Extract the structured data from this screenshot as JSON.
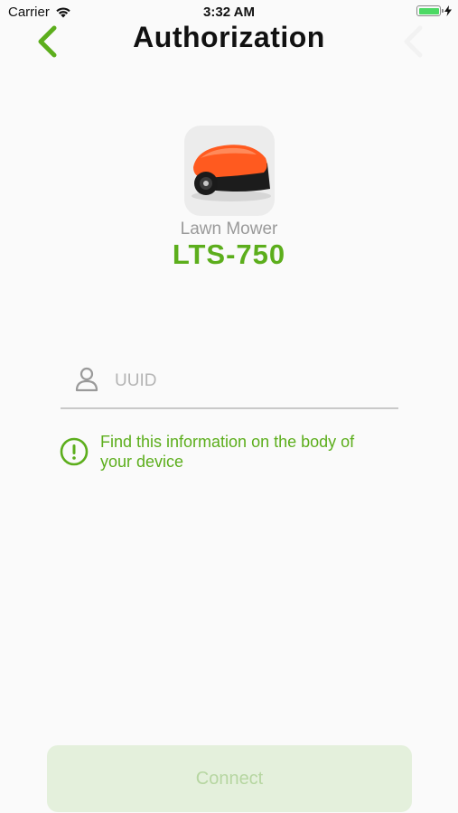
{
  "status_bar": {
    "carrier": "Carrier",
    "time": "3:32 AM",
    "wifi_icon": "wifi-icon",
    "battery_icon": "battery-icon",
    "charging_icon": "bolt-icon"
  },
  "nav": {
    "title": "Authorization",
    "back_icon": "chevron-left-icon"
  },
  "device": {
    "image_icon": "lawn-mower-robot",
    "type": "Lawn Mower",
    "model": "LTS-750"
  },
  "form": {
    "uuid_placeholder": "UUID",
    "uuid_value": "",
    "field_icon": "user-icon"
  },
  "hint": {
    "icon": "info-circle-icon",
    "text": "Find this information on the body of your device"
  },
  "actions": {
    "connect_label": "Connect"
  },
  "colors": {
    "accent": "#5cae1c",
    "button_bg_disabled": "#e4f0dc",
    "button_text_disabled": "#b6d6a1",
    "background": "#fafafa"
  }
}
